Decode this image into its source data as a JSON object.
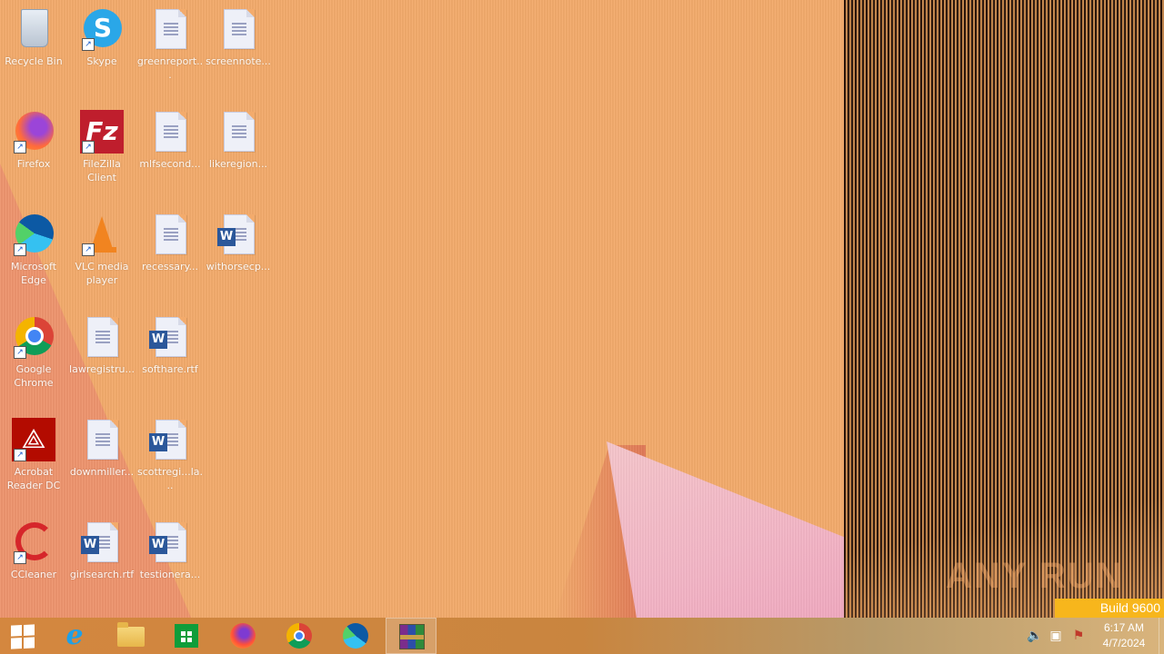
{
  "desktop": {
    "icons": [
      {
        "label": "Recycle Bin",
        "icon": "recycle-bin-icon"
      },
      {
        "label": "Skype",
        "icon": "skype-icon"
      },
      {
        "label": "greenreport...",
        "icon": "document-icon"
      },
      {
        "label": "screennote...",
        "icon": "document-icon"
      },
      {
        "label": "Firefox",
        "icon": "firefox-icon"
      },
      {
        "label": "FileZilla Client",
        "icon": "filezilla-icon"
      },
      {
        "label": "mlfsecond...",
        "icon": "document-icon"
      },
      {
        "label": "likeregion...",
        "icon": "document-icon"
      },
      {
        "label": "Microsoft Edge",
        "icon": "edge-icon"
      },
      {
        "label": "VLC media player",
        "icon": "vlc-icon"
      },
      {
        "label": "recessary...",
        "icon": "document-icon"
      },
      {
        "label": "withorsecp...",
        "icon": "word-document-icon"
      },
      {
        "label": "Google Chrome",
        "icon": "chrome-icon"
      },
      {
        "label": "lawregistru...",
        "icon": "document-icon"
      },
      {
        "label": "softhare.rtf",
        "icon": "word-document-icon"
      },
      {
        "label": "Acrobat Reader DC",
        "icon": "acrobat-icon"
      },
      {
        "label": "downmiller...",
        "icon": "document-icon"
      },
      {
        "label": "scottregi...la...",
        "icon": "word-document-icon"
      },
      {
        "label": "CCleaner",
        "icon": "ccleaner-icon"
      },
      {
        "label": "girlsearch.rtf",
        "icon": "word-document-icon"
      },
      {
        "label": "testionera...",
        "icon": "word-document-icon"
      }
    ]
  },
  "watermark": {
    "text": "ANY RUN"
  },
  "build_badge": {
    "text": "Build 9600"
  },
  "taskbar": {
    "items": [
      {
        "name": "start",
        "icon": "windows-logo-icon"
      },
      {
        "name": "internet-explorer",
        "icon": "internet-explorer-icon"
      },
      {
        "name": "file-explorer",
        "icon": "file-explorer-icon"
      },
      {
        "name": "store",
        "icon": "store-icon"
      },
      {
        "name": "firefox",
        "icon": "firefox-icon"
      },
      {
        "name": "chrome",
        "icon": "chrome-icon"
      },
      {
        "name": "edge",
        "icon": "edge-icon"
      },
      {
        "name": "winrar",
        "icon": "winrar-icon",
        "active": true
      }
    ],
    "tray": {
      "icons": [
        "speaker-icon",
        "network-icon",
        "action-center-flag-icon"
      ],
      "time": "6:17 AM",
      "date": "4/7/2024"
    }
  },
  "colors": {
    "wallpaper": "#f3ab6c",
    "badge": "#f7b61c",
    "taskbar": "#c9853f"
  }
}
